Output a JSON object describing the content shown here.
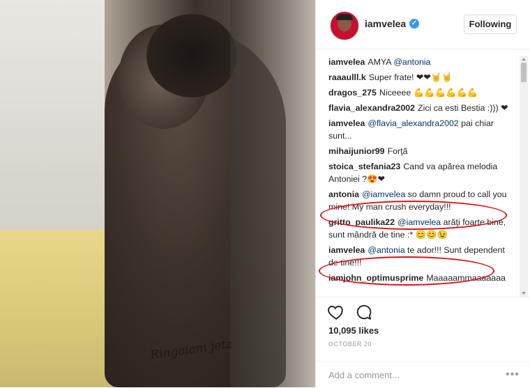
{
  "post": {
    "username": "iamvelea",
    "verified_mark": "✓",
    "follow_label": "Following",
    "photo_signature": "Ringaiam jetz",
    "comments": [
      {
        "user": "iamvelea",
        "pre": "AMYA ",
        "mention": "@antonia",
        "post": ""
      },
      {
        "user": "raaaulll.k",
        "pre": "Super frate! ❤❤🤘🤘",
        "mention": "",
        "post": ""
      },
      {
        "user": "dragos_275",
        "pre": "Niceeee 💪💪💪💪💪💪",
        "mention": "",
        "post": ""
      },
      {
        "user": "flavia_alexandra2002",
        "pre": "Zici ca esti Bestia :))) ❤",
        "mention": "",
        "post": ""
      },
      {
        "user": "iamvelea",
        "pre": "",
        "mention": "@flavia_alexandra2002",
        "post": " pai chiar sunt..."
      },
      {
        "user": "mihaijunior99",
        "pre": "Forţă",
        "mention": "",
        "post": ""
      },
      {
        "user": "stoica_stefania23",
        "pre": "Cand va apărea melodia Antoniei ?😍❤",
        "mention": "",
        "post": ""
      },
      {
        "user": "antonia",
        "pre": "",
        "mention": "@iamvelea",
        "post": " so damn proud to call you mine! My man crush everyday!!!"
      },
      {
        "user": "gritto_paulika22",
        "pre": "",
        "mention": "@iamvelea",
        "post": " arăţi foarte bine, sunt mândră de tine :* 😊😊😉"
      },
      {
        "user": "iamvelea",
        "pre": "",
        "mention": "@antonia",
        "post": " te ador!!! Sunt dependent de tine!!!"
      },
      {
        "user": "iamjohn_optimusprime",
        "pre": "Maaaaammaaaaaaa",
        "mention": "",
        "post": ""
      }
    ],
    "likes": "10,095 likes",
    "date": "OCTOBER 20",
    "add_comment_placeholder": "Add a comment...",
    "more_dots": "•••",
    "colors": {
      "mention": "#003569",
      "highlight": "#d9151b",
      "verified": "#3897f0"
    },
    "icons": [
      "heart-icon",
      "comment-icon",
      "more-options-icon",
      "verified-badge-icon"
    ]
  }
}
